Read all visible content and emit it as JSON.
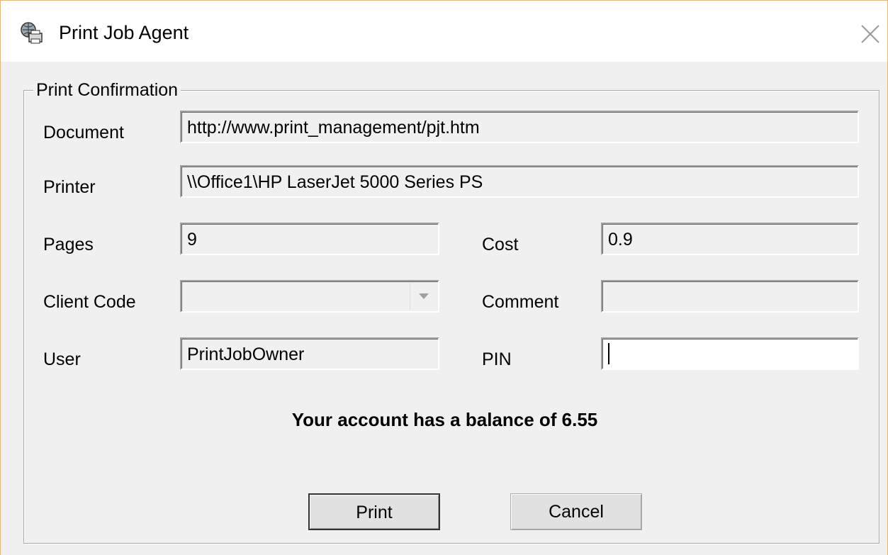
{
  "window": {
    "title": "Print Job Agent",
    "icon": "printer-globe-icon",
    "close_icon": "close-icon"
  },
  "group": {
    "legend": "Print Confirmation"
  },
  "fields": {
    "document": {
      "label": "Document",
      "value": "http://www.print_management/pjt.htm"
    },
    "printer": {
      "label": "Printer",
      "value": "\\\\Office1\\HP LaserJet 5000 Series PS"
    },
    "pages": {
      "label": "Pages",
      "value": "9"
    },
    "cost": {
      "label": "Cost",
      "value": "0.9"
    },
    "client_code": {
      "label": "Client Code",
      "value": ""
    },
    "comment": {
      "label": "Comment",
      "value": ""
    },
    "user": {
      "label": "User",
      "value": "PrintJobOwner"
    },
    "pin": {
      "label": "PIN",
      "value": ""
    }
  },
  "balance_message": "Your account has a balance of 6.55",
  "buttons": {
    "print": "Print",
    "cancel": "Cancel"
  }
}
